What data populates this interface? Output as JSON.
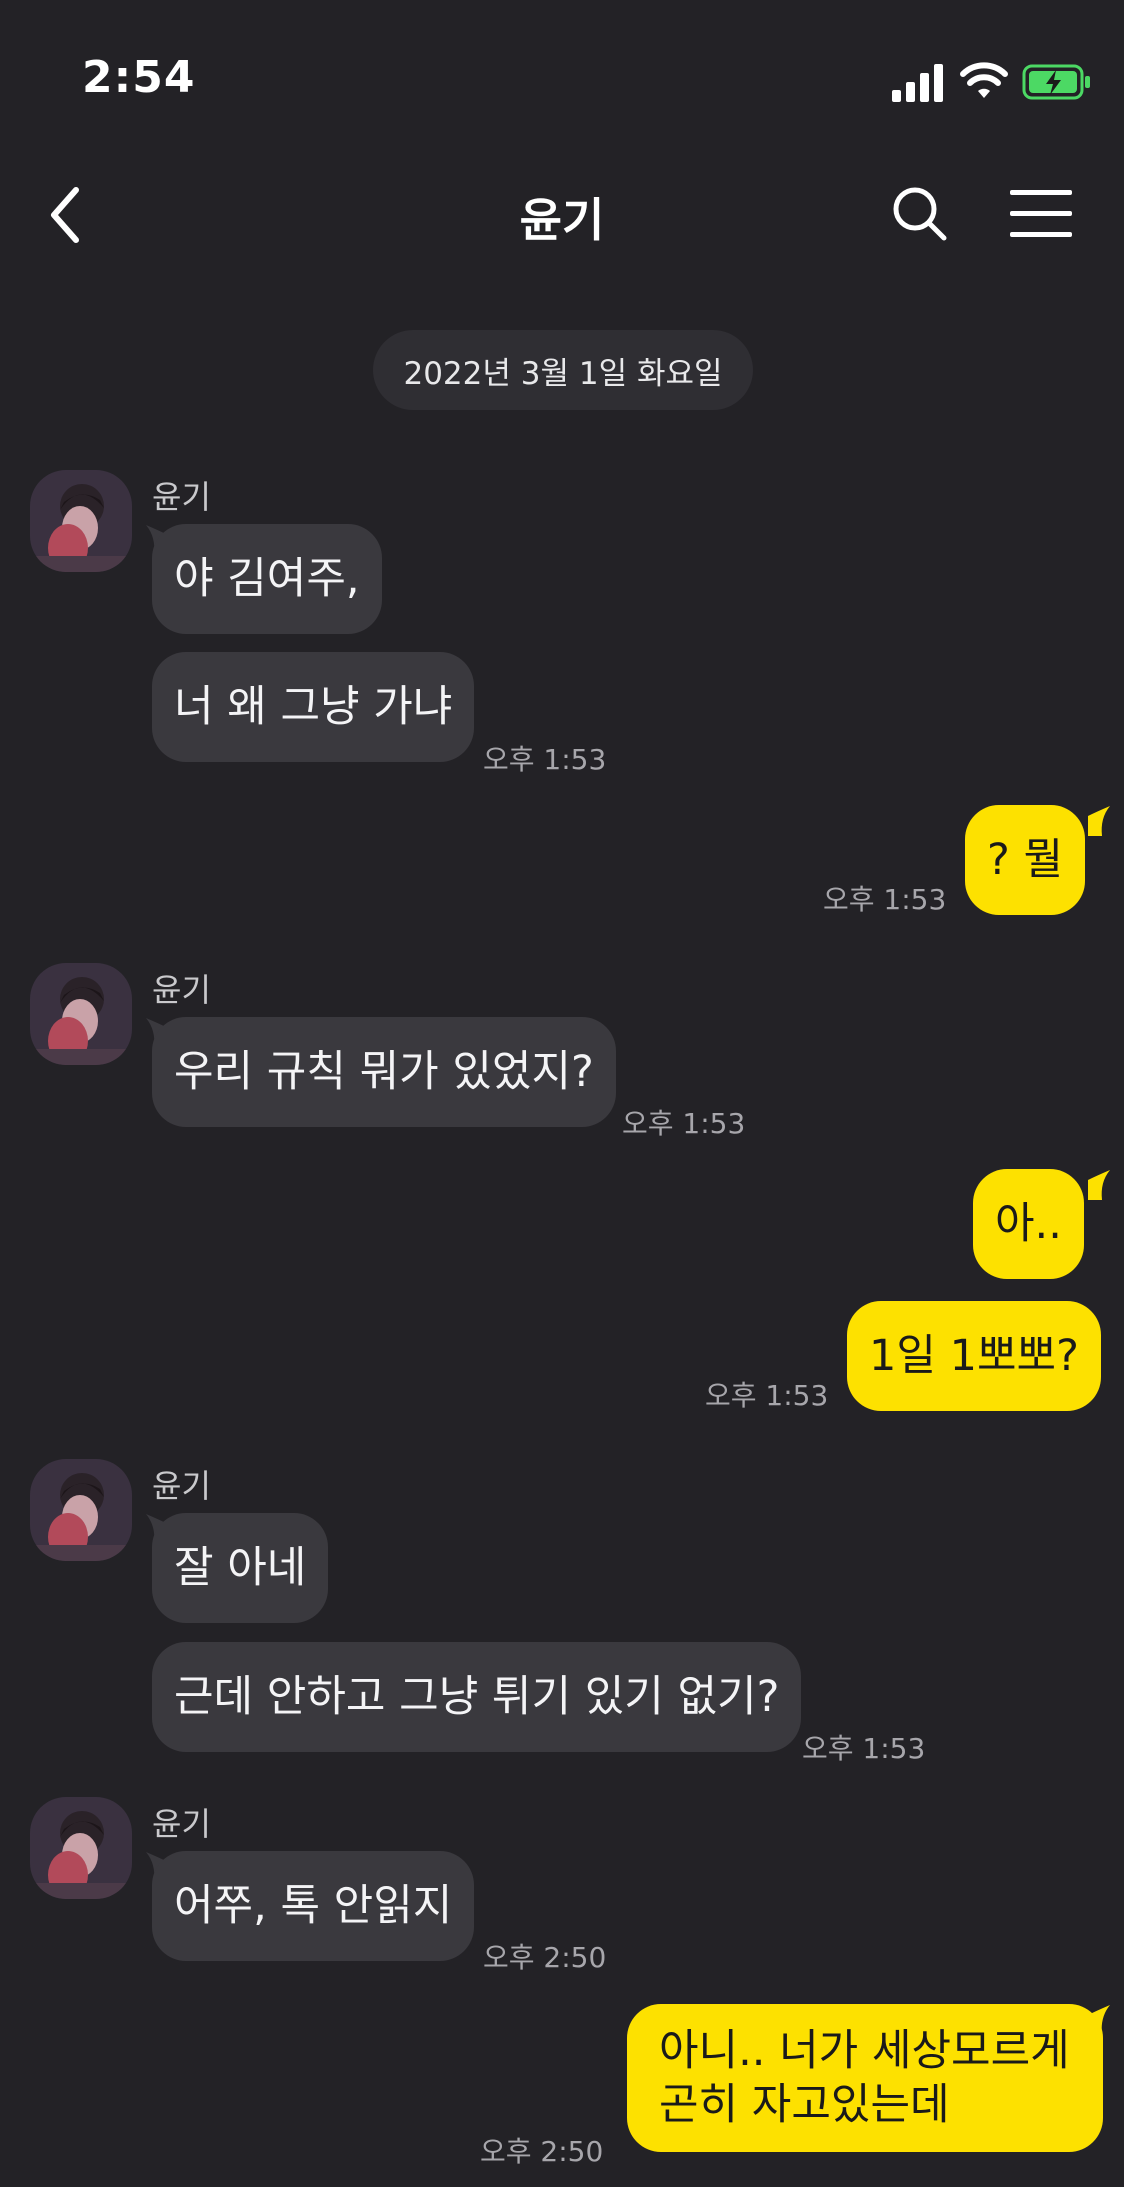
{
  "status_bar": {
    "time": "2:54"
  },
  "header": {
    "title": "윤기"
  },
  "date_divider": "2022년 3월 1일 화요일",
  "messages": [
    {
      "sender": "윤기",
      "text": "야 김여주,",
      "time": ""
    },
    {
      "sender": "윤기",
      "text": "너 왜 그냥 가냐",
      "time": "오후 1:53"
    },
    {
      "sender": "me",
      "text": "? 뭘",
      "time": "오후 1:53"
    },
    {
      "sender": "윤기",
      "text": "우리 규칙 뭐가 있었지?",
      "time": "오후 1:53"
    },
    {
      "sender": "me",
      "text": "아..",
      "time": ""
    },
    {
      "sender": "me",
      "text": "1일 1뽀뽀?",
      "time": "오후 1:53"
    },
    {
      "sender": "윤기",
      "text": "잘 아네",
      "time": ""
    },
    {
      "sender": "윤기",
      "text": "근데 안하고 그냥 튀기 있기 없기?",
      "time": "오후 1:53"
    },
    {
      "sender": "윤기",
      "text": "어쭈, 톡 안읽지",
      "time": "오후 2:50"
    },
    {
      "sender": "me",
      "text_line1": "아니.. 너가 세상모르게",
      "text_line2": "곤히 자고있는데",
      "time": "오후 2:50"
    }
  ],
  "colors": {
    "background": "#232226",
    "incoming_bubble": "#3a393e",
    "outgoing_bubble": "#fde100",
    "battery_charging": "#4cd964"
  }
}
